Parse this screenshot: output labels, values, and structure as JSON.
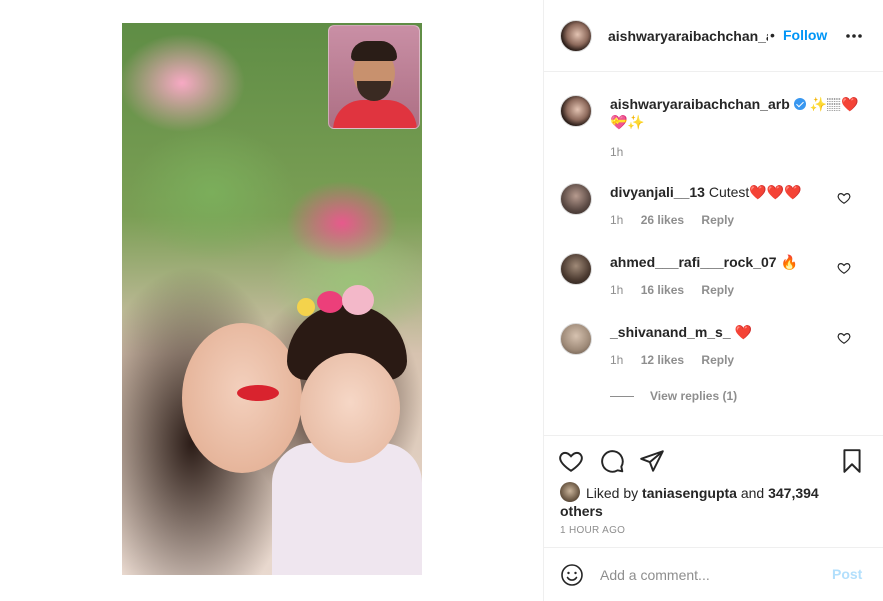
{
  "header": {
    "username": "aishwaryaraibachchan_arb",
    "separator": "•",
    "follow_label": "Follow",
    "more_icon": "more-horizontal-icon"
  },
  "caption": {
    "username": "aishwaryaraibachchan_arb",
    "verified": true,
    "text": "✨🏽❤️💝✨",
    "time": "1h"
  },
  "comments": [
    {
      "username": "divyanjali__13",
      "text": "Cutest❤️❤️❤️",
      "time": "1h",
      "likes": "26 likes",
      "reply": "Reply"
    },
    {
      "username": "ahmed___rafi___rock_07",
      "text": "🔥",
      "time": "1h",
      "likes": "16 likes",
      "reply": "Reply"
    },
    {
      "username": "_shivanand_m_s_",
      "text": "❤️",
      "time": "1h",
      "likes": "12 likes",
      "reply": "Reply"
    }
  ],
  "view_replies": "View replies (1)",
  "actions": {
    "liked_by_prefix": "Liked by",
    "liked_by_user": "taniasengupta",
    "liked_by_and": "and",
    "liked_others": "347,394 others",
    "time_ago": "1 HOUR AGO"
  },
  "add_comment": {
    "placeholder": "Add a comment...",
    "post_label": "Post"
  },
  "colors": {
    "link": "#0095f6",
    "post_disabled": "#b2dffc",
    "meta": "#8e8e8e",
    "text": "#262626"
  }
}
